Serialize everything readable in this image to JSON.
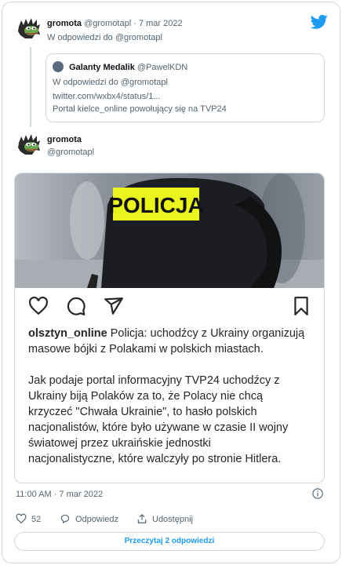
{
  "brand": {
    "accent": "#1d9bf0",
    "border": "#cfd9de",
    "muted": "#536471"
  },
  "tweet1": {
    "name": "gromota",
    "handle": "@gromotapl",
    "separator": "·",
    "date": "7 mar 2022",
    "reply_prefix": "W odpowiedzi do",
    "reply_to": "@gromotapl"
  },
  "quote": {
    "name": "Galanty Medalik",
    "handle": "@PawelKDN",
    "reply_line": "W odpowiedzi do @gromotapl",
    "link": "twitter.com/wxbx4/status/1...",
    "text": "Portal kielce_online powołujący się na TVP24"
  },
  "tweet2": {
    "name": "gromota",
    "handle": "@gromotapl"
  },
  "post": {
    "image_label": "POLICJA",
    "username": "olsztyn_online",
    "lines": [
      " Policja: uchodźcy z Ukrainy organizują",
      "masowe bójki z Polakami w polskich miastach.",
      "",
      "Jak podaje portal informacyjny TVP24 uchodźcy z",
      "Ukrainy biją Polaków za to, że Polacy nie chcą",
      "krzyczeć \"Chwała Ukrainie\", to hasło polskich",
      "nacjonalistów, które było używane w czasie II wojny",
      "światowej przez ukraińskie jednostki",
      "nacjonalistyczne, które walczyły po stronie Hitlera."
    ]
  },
  "meta": {
    "time": "11:00 AM · 7 mar 2022"
  },
  "actions": {
    "likes": "52",
    "reply_label": "Odpowiedz",
    "share_label": "Udostępnij"
  },
  "replies_button": "Przeczytaj 2 odpowiedzi",
  "icons": [
    "twitter-bird-icon",
    "heart-icon",
    "comment-icon",
    "send-icon",
    "bookmark-icon",
    "info-icon",
    "reply-icon",
    "share-icon"
  ]
}
